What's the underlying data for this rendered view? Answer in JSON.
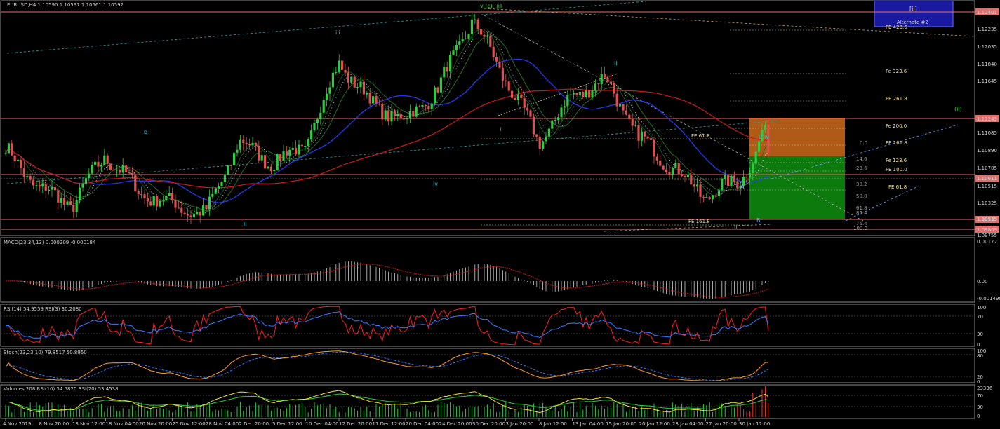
{
  "colors": {
    "background": "#000000",
    "bull": "#2ecc40",
    "bear": "#e05050",
    "resistance": "#e07070",
    "ma_blue": "#2a3cff",
    "ma_red": "#d01818",
    "fib_text": "#f0e08a",
    "wave_cyan": "#37c6c0",
    "wave_green": "#3cdc3c",
    "macd": "#d0d0d0",
    "rsi14": "#3a7aff",
    "rsi3": "#ff2020",
    "stoch_main": "#ff9a20",
    "stoch_signal": "#3a7aff",
    "box_orange": "#b05a18",
    "box_green": "#0c7a0c",
    "alt_box": "#1a1aa0"
  },
  "main": {
    "header": "EURUSD,H4  1.10590 1.10597 1.10561 1.10592",
    "price_labels": [
      "1.12401",
      "1.12235",
      "1.12035",
      "1.11840",
      "1.11645",
      "1.11243",
      "1.11085",
      "1.10890",
      "1.10705",
      "1.10611",
      "1.10515",
      "1.10325",
      "1.10135",
      "1.09919",
      "1.09809",
      "1.09755"
    ],
    "fib_levels": [
      "FE 423.6",
      "Fe 323.6",
      "FE 261.8",
      "Fe 200.0",
      "FE 161.8",
      "Fe 123.6",
      "FE 100.0",
      "FE 61.8",
      "FE 61.8",
      "FE 161.8"
    ],
    "retrace_levels": [
      "0.0",
      "14.6",
      "23.6",
      "38.2",
      "50.0",
      "61.8",
      "76.4",
      "85.4",
      "100.0"
    ],
    "waves": [
      "v (c) [ii]",
      "iii",
      "b",
      "iv",
      "ii",
      "i",
      "i",
      "ii",
      "iii",
      "C iv",
      "A",
      "B",
      "(ii)"
    ],
    "alternate": {
      "label": "[ii]",
      "sub": "Alternate #2"
    }
  },
  "time_labels": [
    "4 Nov 2019",
    "8 Nov 20:00",
    "13 Nov 12:00",
    "18 Nov 04:00",
    "20 Nov 20:00",
    "25 Nov 12:00",
    "28 Nov 04:00",
    "2 Dec 20:00",
    "5 Dec 12:00",
    "10 Dec 04:00",
    "12 Dec 20:00",
    "17 Dec 12:00",
    "20 Dec 04:00",
    "24 Dec 20:00",
    "30 Dec 20:00",
    "3 Jan 20:00",
    "8 Jan 12:00",
    "13 Jan 04:00",
    "15 Jan 20:00",
    "20 Jan 12:00",
    "23 Jan 04:00",
    "27 Jan 20:00",
    "30 Jan 12:00"
  ],
  "macd": {
    "header": "MACD(23,34,13) 0.000209 -0.000184",
    "labels": [
      "0.00172",
      "0.00",
      "-0.001498"
    ]
  },
  "rsi": {
    "header": "RSI(14) 54.9559  RSI(3) 30.2080",
    "labels": [
      "100",
      "70",
      "30",
      "0"
    ]
  },
  "stoch": {
    "header": "Stoch(23,23,10) 79.8517 50.8950",
    "labels": [
      "100",
      "80",
      "20",
      "0"
    ]
  },
  "volumes": {
    "header": "Volumes 208  RSI(10) 54.5820  RSI(20) 53.4538",
    "labels": [
      "23336",
      "70",
      "30",
      "0"
    ]
  },
  "chart_data": {
    "type": "candlestick",
    "symbol": "EURUSD",
    "timeframe": "H4",
    "ylim": [
      1.09755,
      1.1251
    ],
    "key_levels": [
      1.12401,
      1.11243,
      1.10611,
      1.09919,
      1.09809
    ],
    "path_x": [
      "4 Nov 2019",
      "8 Nov 20:00",
      "13 Nov 12:00",
      "18 Nov 04:00",
      "20 Nov 20:00",
      "25 Nov 12:00",
      "28 Nov 04:00",
      "2 Dec 20:00",
      "5 Dec 12:00",
      "10 Dec 04:00",
      "12 Dec 20:00",
      "17 Dec 12:00",
      "20 Dec 04:00",
      "24 Dec 20:00",
      "30 Dec 20:00",
      "3 Jan 20:00",
      "8 Jan 12:00",
      "13 Jan 04:00",
      "15 Jan 20:00",
      "20 Jan 12:00",
      "23 Jan 04:00",
      "27 Jan 20:00",
      "30 Jan 12:00"
    ],
    "path_close": [
      1.1075,
      1.103,
      1.101,
      1.107,
      1.1025,
      1.101,
      1.0998,
      1.1085,
      1.106,
      1.108,
      1.118,
      1.113,
      1.111,
      1.115,
      1.1232,
      1.116,
      1.1085,
      1.114,
      1.116,
      1.109,
      1.1055,
      1.102,
      1.104
    ],
    "tail_close": [
      1.107,
      1.11,
      1.1059
    ]
  }
}
